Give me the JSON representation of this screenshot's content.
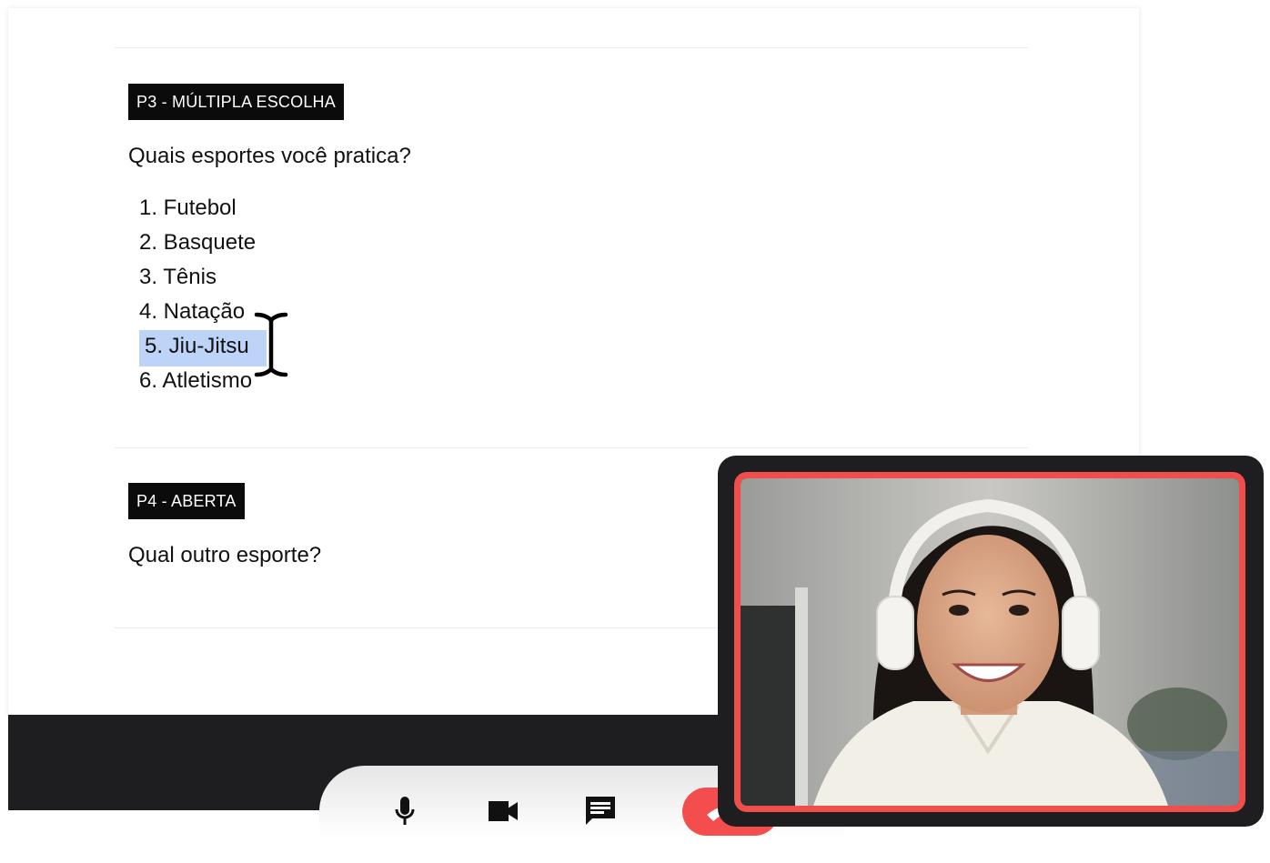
{
  "questions": [
    {
      "tag": "P3 - MÚLTIPLA ESCOLHA",
      "text": "Quais esportes você pratica?",
      "options": [
        "1. Futebol",
        "2. Basquete",
        "3. Tênis",
        "4. Natação",
        "5. Jiu-Jitsu",
        "6. Atletismo"
      ],
      "selected_option": "5. Jiu-Jitsu"
    },
    {
      "tag": "P4 - ABERTA",
      "text": "Qual outro esporte?"
    }
  ],
  "call_controls": {
    "icons": [
      "microphone-icon",
      "video-camera-icon",
      "chat-icon",
      "hang-up-icon"
    ]
  },
  "colors": {
    "tag_background": "#0b0b0b",
    "selection_highlight": "#bdd3f7",
    "hang_up": "#f34d4d",
    "video_border": "#f04e4b",
    "dark_panel": "#1e1e20"
  }
}
